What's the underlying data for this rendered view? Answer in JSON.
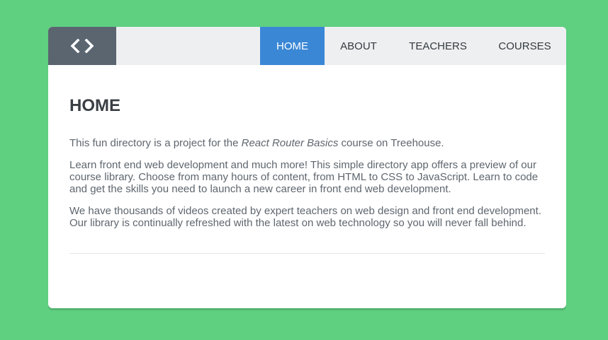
{
  "header": {
    "logo_icon": "code-brackets-icon",
    "nav": [
      {
        "label": "HOME",
        "active": true
      },
      {
        "label": "ABOUT",
        "active": false
      },
      {
        "label": "TEACHERS",
        "active": false
      },
      {
        "label": "COURSES",
        "active": false
      }
    ]
  },
  "main": {
    "title": "HOME",
    "paragraph1": {
      "before": "This fun directory is a project for the ",
      "emphasis": "React Router Basics",
      "after": " course on Treehouse."
    },
    "paragraph2": "Learn front end web development and much more! This simple directory app offers a preview of our course library. Choose from many hours of content, from HTML to CSS to JavaScript. Learn to code and get the skills you need to launch a new career in front end web development.",
    "paragraph3": "We have thousands of videos created by expert teachers on web design and front end development. Our library is continually refreshed with the latest on web technology so you will never fall behind."
  },
  "colors": {
    "background": "#5fcf80",
    "logo_bg": "#5a6570",
    "header_bg": "#eeeff0",
    "active_nav": "#3a87d6"
  }
}
